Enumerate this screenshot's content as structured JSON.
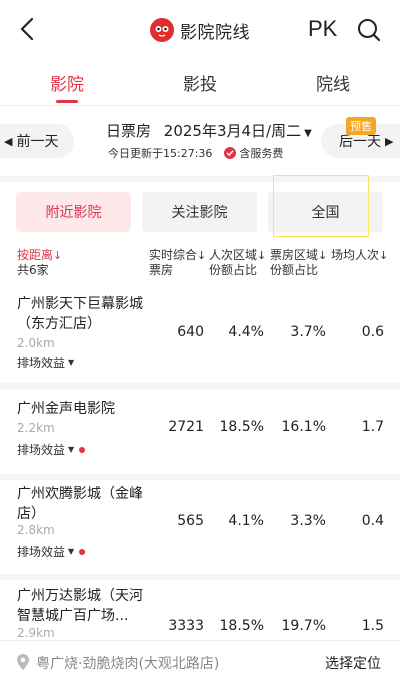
{
  "header": {
    "title": "影院院线",
    "pk_label": "PK"
  },
  "tabs": [
    {
      "label": "影院"
    },
    {
      "label": "影投"
    },
    {
      "label": "院线"
    }
  ],
  "date_bar": {
    "prev_label": "前一天",
    "next_label": "后一天",
    "presale_badge": "预售",
    "box_office_label": "日票房",
    "date_text": "2025年3月4日/周二",
    "update_text": "今日更新于15:27:36",
    "fee_text": "含服务费"
  },
  "filters": [
    {
      "label": "附近影院"
    },
    {
      "label": "关注影院"
    },
    {
      "label": "全国"
    }
  ],
  "table": {
    "sort_label": "按距离",
    "count_label": "共6家",
    "columns": [
      {
        "line1": "实时综合",
        "line2": "票房"
      },
      {
        "line1": "人次区域",
        "line2": "份额占比"
      },
      {
        "line1": "票房区域",
        "line2": "份额占比"
      },
      {
        "line1": "场均人次",
        "line2": ""
      }
    ],
    "rows": [
      {
        "name": "广州影天下巨幕影城（东方汇店）",
        "distance": "2.0km",
        "efficiency": "排场效益",
        "dot": false,
        "box_office": "640",
        "audience_share": "4.4%",
        "box_share": "3.7%",
        "avg_audience": "0.6"
      },
      {
        "name": "广州金声电影院",
        "distance": "2.2km",
        "efficiency": "排场效益",
        "dot": true,
        "box_office": "2721",
        "audience_share": "18.5%",
        "box_share": "16.1%",
        "avg_audience": "1.7"
      },
      {
        "name": "广州欢腾影城（金峰店）",
        "distance": "2.8km",
        "efficiency": "排场效益",
        "dot": true,
        "box_office": "565",
        "audience_share": "4.1%",
        "box_share": "3.3%",
        "avg_audience": "0.4"
      },
      {
        "name": "广州万达影城（天河智慧城广百广场...",
        "distance": "2.9km",
        "efficiency": "排场效益",
        "dot": false,
        "box_office": "3333",
        "audience_share": "18.5%",
        "box_share": "19.7%",
        "avg_audience": "1.5"
      }
    ]
  },
  "bottom": {
    "location": "粤广烧·劲脆烧肉(大观北路店)",
    "choose_location": "选择定位"
  },
  "colors": {
    "accent": "#e0344a",
    "presale": "#f5a623"
  }
}
